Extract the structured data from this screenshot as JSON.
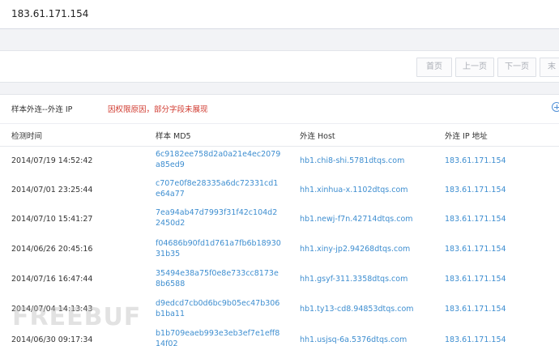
{
  "header": {
    "ip_title": "183.61.171.154"
  },
  "pager": {
    "first": "首页",
    "prev": "上一页",
    "next": "下一页",
    "last": "末"
  },
  "section": {
    "title": "样本外连--外连 IP",
    "notice": "因权限原因，部分字段未展现"
  },
  "table": {
    "columns": [
      "检测时间",
      "样本 MD5",
      "外连 Host",
      "外连 IP 地址"
    ],
    "rows": [
      {
        "time": "2014/07/19 14:52:42",
        "md5": "6c9182ee758d2a0a21e4ec2079a85ed9",
        "host": "hb1.chi8-shi.5781dtqs.com",
        "ip": "183.61.171.154"
      },
      {
        "time": "2014/07/01 23:25:44",
        "md5": "c707e0f8e28335a6dc72331cd1e64a77",
        "host": "hh1.xinhua-x.1102dtqs.com",
        "ip": "183.61.171.154"
      },
      {
        "time": "2014/07/10 15:41:27",
        "md5": "7ea94ab47d7993f31f42c104d22450d2",
        "host": "hb1.newj-f7n.42714dtqs.com",
        "ip": "183.61.171.154"
      },
      {
        "time": "2014/06/26 20:45:16",
        "md5": "f04686b90fd1d761a7fb6b1893031b35",
        "host": "hh1.xiny-jp2.94268dtqs.com",
        "ip": "183.61.171.154"
      },
      {
        "time": "2014/07/16 16:47:44",
        "md5": "35494e38a75f0e8e733cc8173e8b6588",
        "host": "hh1.gsyf-311.3358dtqs.com",
        "ip": "183.61.171.154"
      },
      {
        "time": "2014/07/04 14:13:43",
        "md5": "d9edcd7cb0d6bc9b05ec47b306b1ba11",
        "host": "hb1.ty13-cd8.94853dtqs.com",
        "ip": "183.61.171.154"
      },
      {
        "time": "2014/06/30 09:17:34",
        "md5": "b1b709eaeb993e3eb3ef7e1eff814f02",
        "host": "hh1.usjsq-6a.5376dtqs.com",
        "ip": "183.61.171.154"
      }
    ]
  },
  "watermark": "FREEBUF"
}
